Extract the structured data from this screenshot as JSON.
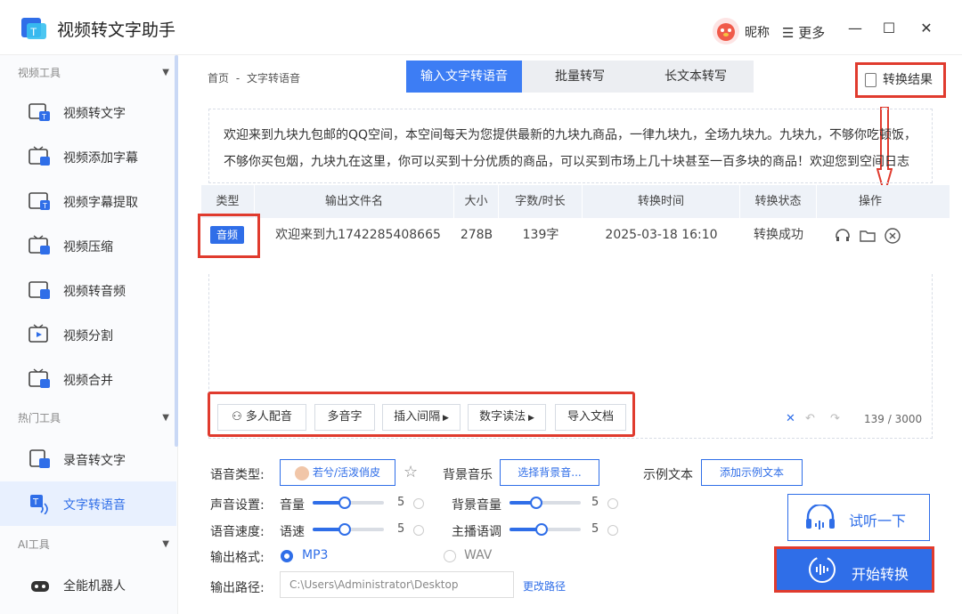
{
  "app": {
    "title": "视频转文字助手",
    "nickname": "昵称",
    "more": "更多"
  },
  "window_controls": {
    "minimize": "—",
    "maximize": "☐",
    "close": "✕"
  },
  "sidebar": {
    "sections": [
      {
        "title": "视频工具"
      },
      {
        "title": "热门工具"
      },
      {
        "title": "AI工具"
      }
    ],
    "items": [
      {
        "label": "视频转文字"
      },
      {
        "label": "视频添加字幕"
      },
      {
        "label": "视频字幕提取"
      },
      {
        "label": "视频压缩"
      },
      {
        "label": "视频转音频"
      },
      {
        "label": "视频分割"
      },
      {
        "label": "视频合并"
      },
      {
        "label": "录音转文字"
      },
      {
        "label": "文字转语音"
      },
      {
        "label": "全能机器人"
      }
    ],
    "active_item": "文字转语音"
  },
  "breadcrumb": {
    "home": "首页",
    "sep": "-",
    "current": "文字转语音"
  },
  "tabs": [
    {
      "label": "输入文字转语音",
      "active": true
    },
    {
      "label": "批量转写",
      "active": false
    },
    {
      "label": "长文本转写",
      "active": false
    }
  ],
  "result_button": "转换结果",
  "input_text": "欢迎来到九块九包邮的QQ空间，本空间每天为您提供最新的九块九商品，一律九块九，全场九块九。九块九，不够你吃顿饭，不够你买包烟，九块九在这里，你可以买到十分优质的商品，可以买到市场上几十块甚至一百多块的商品！欢迎您到空间日志",
  "table": {
    "headers": [
      "类型",
      "输出文件名",
      "大小",
      "字数/时长",
      "转换时间",
      "转换状态",
      "操作"
    ],
    "rows": [
      {
        "type": "音频",
        "filename": "欢迎来到九1742285408665",
        "size": "278B",
        "length": "139字",
        "time": "2025-03-18 16:10",
        "status": "转换成功"
      }
    ]
  },
  "tools": [
    "多人配音",
    "多音字",
    "插入间隔",
    "数字读法",
    "导入文档"
  ],
  "char_count": "139 / 3000",
  "settings": {
    "voice_type_label": "语音类型:",
    "voice_name": "若兮/活泼俏皮",
    "bgm_label": "背景音乐",
    "bgm_button": "选择背景音...",
    "sample_label": "示例文本",
    "sample_button": "添加示例文本",
    "sound_label": "声音设置:",
    "volume_label": "音量",
    "volume_value": "5",
    "bg_volume_label": "背景音量",
    "bg_volume_value": "5",
    "speed_label": "语音速度:",
    "speed_name": "语速",
    "speed_value": "5",
    "tone_label": "主播语调",
    "tone_value": "5",
    "format_label": "输出格式:",
    "format_mp3": "MP3",
    "format_wav": "WAV",
    "selected_format": "MP3",
    "path_label": "输出路径:",
    "path_value": "C:\\Users\\Administrator\\Desktop",
    "change_path": "更改路径"
  },
  "listen_button": "试听一下",
  "start_button": "开始转换",
  "colors": {
    "accent": "#2f6ee8",
    "highlight": "#e03b2e"
  }
}
